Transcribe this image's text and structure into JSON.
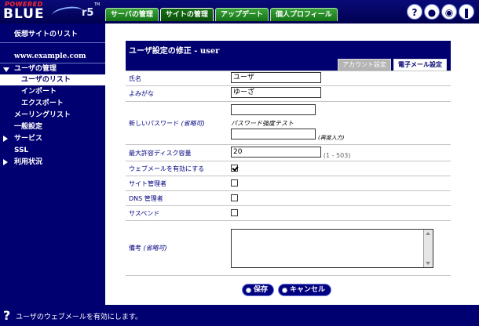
{
  "logo": {
    "powered": "POWERED",
    "name": "BLUE",
    "version": "r5",
    "mark": "TM"
  },
  "tabs": [
    {
      "label": "サーバの管理"
    },
    {
      "label": "サイトの管理",
      "active": true
    },
    {
      "label": "アップデート"
    },
    {
      "label": "個人プロフィール"
    }
  ],
  "top_icons": [
    {
      "name": "help-icon",
      "glyph": "?"
    },
    {
      "name": "user-icon",
      "glyph": "●"
    },
    {
      "name": "eye-icon",
      "glyph": "◉"
    },
    {
      "name": "logout-icon",
      "glyph": "❚"
    }
  ],
  "sidebar": {
    "virtual_sites": "仮想サイトのリスト",
    "site_name": "www.example.com",
    "user_mgmt": "ユーザの管理",
    "user_list": "ユーザのリスト",
    "import": "インポート",
    "export": "エクスポート",
    "mailing_list": "メーリングリスト",
    "general": "一般設定",
    "services": "サービス",
    "ssl": "SSL",
    "usage": "利用状況"
  },
  "panel": {
    "title": "ユーザ設定の修正 - user",
    "subtabs": [
      {
        "label": "アカウント設定"
      },
      {
        "label": "電子メール設定",
        "active": true
      }
    ]
  },
  "form": {
    "name_label": "氏名",
    "name_value": "ユーザ",
    "yomi_label": "よみがな",
    "yomi_value": "ゆーざ",
    "password_label": "新しいパスワード",
    "optional": "(省略可)",
    "strength_label": "パスワード強度テスト",
    "reenter_label": "(再度入力)",
    "quota_label": "最大許容ディスク容量",
    "quota_value": "20",
    "quota_range": "(1 - 503)",
    "webmail_label": "ウェブメールを有効にする",
    "webmail_checked": true,
    "site_admin_label": "サイト管理者",
    "dns_admin_label": "DNS 管理者",
    "suspend_label": "サスペンド",
    "notes_label": "備考"
  },
  "buttons": {
    "save": "保存",
    "cancel": "キャンセル"
  },
  "status": {
    "icon": "?",
    "text": "ユーザのウェブメールを有効にします。"
  },
  "colors": {
    "navy": "#000070",
    "tab_green": "#1e8a1e",
    "label_blue": "#000080"
  }
}
